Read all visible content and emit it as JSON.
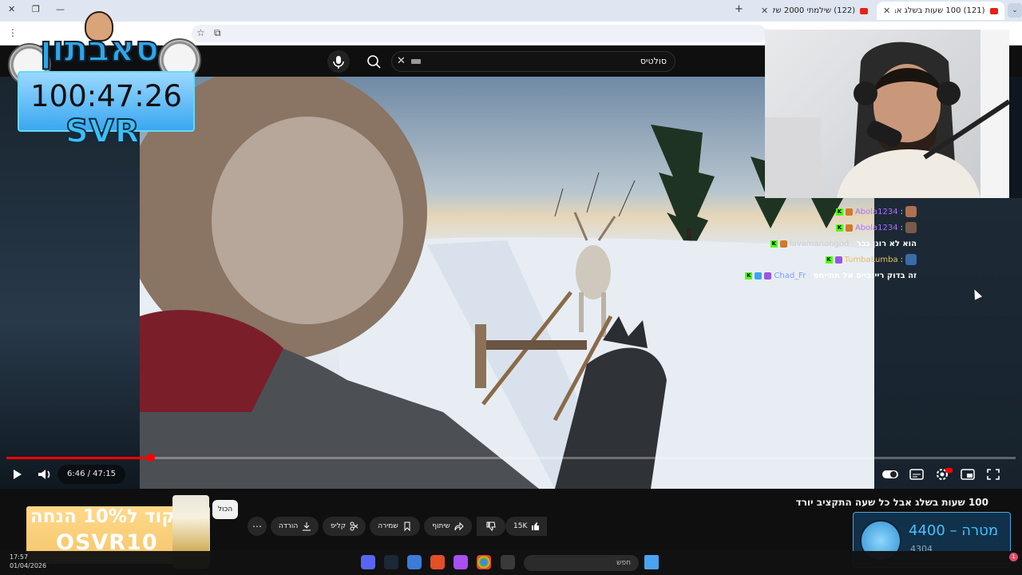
{
  "browser": {
    "tabs": [
      {
        "title": "(121) 100 שעות בשלג אבל כל ש",
        "active": true
      },
      {
        "title": "(122) שילמתי 2000 שקל לצופי",
        "active": false
      }
    ],
    "new_tab": "+",
    "tab_search": "⌄"
  },
  "youtube": {
    "search": {
      "value": "סולטיס"
    },
    "video": {
      "title": "100 שעות בשלג אבל כל שעה התקציב יורד",
      "time_display": "6:46 / 47:15",
      "progress_fraction": 0.143
    },
    "actions": {
      "likes": "15K",
      "share": "שיתוף",
      "save": "שמירה",
      "clip": "קליפ",
      "download": "הורדה"
    },
    "all_tooltip": "הכול"
  },
  "overlay": {
    "logo": "סאבתון",
    "timer": "100:47:26",
    "brand": "SVR",
    "promo_line1": "קוד ל10% הנחה",
    "promo_line2": "OSVR10",
    "goal": {
      "label": "מטרה  –  4400",
      "current": "4304"
    }
  },
  "chat": [
    {
      "user": "Abola1234",
      "message": "",
      "user_color": "#a970ff"
    },
    {
      "user": "Abola1234",
      "message": "",
      "user_color": "#a970ff"
    },
    {
      "user": "lavamanongod",
      "message": "הוא לא רונן גבר",
      "user_color": "#cfcfcf"
    },
    {
      "user": "TumbaLumba",
      "message": "",
      "user_color": "#e0c060"
    },
    {
      "user": "Chad_Fr",
      "message": "זה בדוק רייגבייס אל תתייחס",
      "user_color": "#7aa0ff"
    }
  ],
  "taskbar": {
    "time": "17:57",
    "date": "01/04/2026",
    "search_placeholder": "חפש"
  }
}
